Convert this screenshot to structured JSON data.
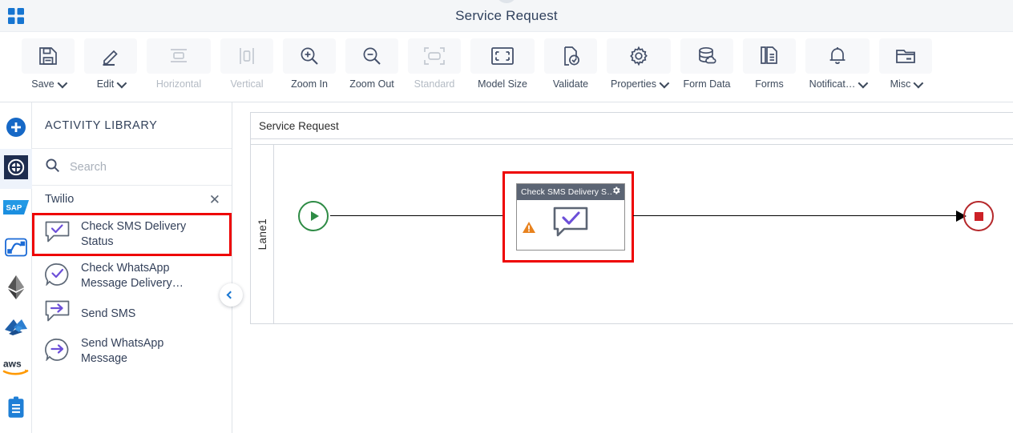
{
  "titlebar": {
    "title": "Service Request",
    "logo_icon": "app-grid-icon"
  },
  "toolbar": {
    "items": [
      {
        "label": "Save",
        "icon": "floppy-disk-icon",
        "caret": true,
        "disabled": false,
        "name": "save"
      },
      {
        "label": "Edit",
        "icon": "pencil-icon",
        "caret": true,
        "disabled": false,
        "name": "edit"
      },
      {
        "label": "Horizontal",
        "icon": "align-horizontal-icon",
        "caret": false,
        "disabled": true,
        "name": "horizontal"
      },
      {
        "label": "Vertical",
        "icon": "align-vertical-icon",
        "caret": false,
        "disabled": true,
        "name": "vertical"
      },
      {
        "label": "Zoom In",
        "icon": "magnifier-plus-icon",
        "caret": false,
        "disabled": false,
        "name": "zoom-in"
      },
      {
        "label": "Zoom Out",
        "icon": "magnifier-minus-icon",
        "caret": false,
        "disabled": false,
        "name": "zoom-out"
      },
      {
        "label": "Standard",
        "icon": "fit-standard-icon",
        "caret": false,
        "disabled": true,
        "name": "standard"
      },
      {
        "label": "Model Size",
        "icon": "expand-frame-icon",
        "caret": false,
        "disabled": false,
        "name": "model-size"
      },
      {
        "label": "Validate",
        "icon": "document-check-icon",
        "caret": false,
        "disabled": false,
        "name": "validate"
      },
      {
        "label": "Properties",
        "icon": "gear-icon",
        "caret": true,
        "disabled": false,
        "name": "properties"
      },
      {
        "label": "Form Data",
        "icon": "database-cloud-icon",
        "caret": false,
        "disabled": false,
        "name": "form-data"
      },
      {
        "label": "Forms",
        "icon": "documents-icon",
        "caret": false,
        "disabled": false,
        "name": "forms"
      },
      {
        "label": "Notificat…",
        "icon": "bell-icon",
        "caret": true,
        "disabled": false,
        "name": "notifications"
      },
      {
        "label": "Misc",
        "icon": "folder-card-icon",
        "caret": true,
        "disabled": false,
        "name": "misc"
      }
    ]
  },
  "rail": {
    "items": [
      {
        "name": "add-new",
        "icon": "plus-circle-icon",
        "active": false
      },
      {
        "name": "activities",
        "icon": "target-grid-icon",
        "active": true
      },
      {
        "name": "sap",
        "icon": "sap-logo-icon",
        "active": false
      },
      {
        "name": "integration",
        "icon": "flow-connector-icon",
        "active": false
      },
      {
        "name": "ethereum",
        "icon": "ethereum-logo-icon",
        "active": false
      },
      {
        "name": "azure",
        "icon": "azure-logo-icon",
        "active": false
      },
      {
        "name": "aws",
        "icon": "aws-logo-icon",
        "active": false
      },
      {
        "name": "clipboard",
        "icon": "clipboard-icon",
        "active": false
      }
    ]
  },
  "library": {
    "title": "ACTIVITY LIBRARY",
    "search": {
      "value": "",
      "placeholder": "Search",
      "icon": "search-icon"
    },
    "group": {
      "name": "Twilio",
      "close_icon": "close-icon"
    },
    "activities": [
      {
        "label": "Check SMS Delivery Status",
        "icon": "speech-check-square-icon",
        "highlighted": true
      },
      {
        "label": "Check WhatsApp Message Delivery…",
        "icon": "speech-check-round-icon",
        "highlighted": false
      },
      {
        "label": "Send SMS",
        "icon": "speech-arrow-square-icon",
        "highlighted": false
      },
      {
        "label": "Send WhatsApp Message",
        "icon": "speech-arrow-round-icon",
        "highlighted": false
      }
    ],
    "collapse_icon": "chevron-left-icon"
  },
  "canvas": {
    "pool_name": "Service Request",
    "lane_name": "Lane1",
    "start_event": {
      "name": "start-event",
      "icon": "play-triangle-icon"
    },
    "task": {
      "title": "Check SMS Delivery S…",
      "gear_icon": "gear-icon",
      "body_icon": "speech-check-icon",
      "warning_icon": "warning-triangle-icon"
    },
    "end_event": {
      "name": "end-event",
      "icon": "stop-square-icon"
    }
  },
  "colors": {
    "accent_blue": "#1675d1",
    "highlight_red": "#ee0000",
    "start_green": "#2e8b45",
    "end_red": "#cc2127",
    "task_header": "#5c6574",
    "warning_orange": "#e8821e",
    "icon_purple": "#6c4fd8",
    "title_text": "#30415d"
  }
}
